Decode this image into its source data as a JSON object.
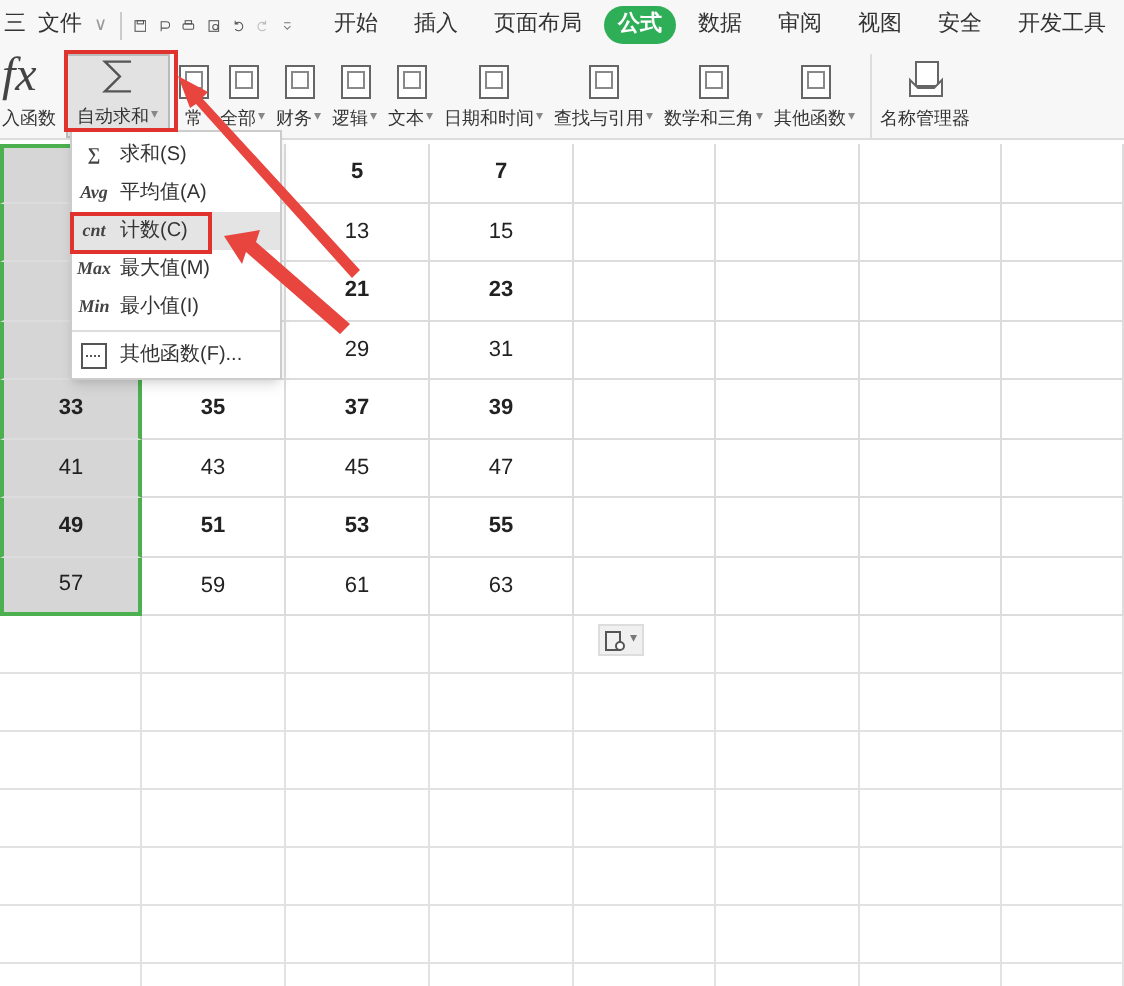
{
  "title_bar": {
    "menu_glyph": "三",
    "file_menu": "文件",
    "file_caret": "∨"
  },
  "menu_tabs": [
    {
      "label": "开始",
      "selected": false
    },
    {
      "label": "插入",
      "selected": false
    },
    {
      "label": "页面布局",
      "selected": false
    },
    {
      "label": "公式",
      "selected": true
    },
    {
      "label": "数据",
      "selected": false
    },
    {
      "label": "审阅",
      "selected": false
    },
    {
      "label": "视图",
      "selected": false
    },
    {
      "label": "安全",
      "selected": false
    },
    {
      "label": "开发工具",
      "selected": false
    }
  ],
  "ribbon": [
    {
      "label": "入函数",
      "kind": "fx",
      "pressed": false
    },
    {
      "label": "自动求和",
      "kind": "sigma",
      "caret": "▾",
      "pressed": true
    },
    {
      "label": "常",
      "kind": "book",
      "pressed": false
    },
    {
      "label": "全部",
      "kind": "book",
      "caret": "▾",
      "pressed": false
    },
    {
      "label": "财务",
      "kind": "book",
      "caret": "▾",
      "pressed": false
    },
    {
      "label": "逻辑",
      "kind": "book",
      "caret": "▾",
      "pressed": false
    },
    {
      "label": "文本",
      "kind": "book",
      "caret": "▾",
      "pressed": false
    },
    {
      "label": "日期和时间",
      "kind": "book",
      "caret": "▾",
      "pressed": false
    },
    {
      "label": "查找与引用",
      "kind": "book",
      "caret": "▾",
      "pressed": false
    },
    {
      "label": "数学和三角",
      "kind": "book",
      "caret": "▾",
      "pressed": false
    },
    {
      "label": "其他函数",
      "kind": "book",
      "caret": "▾",
      "pressed": false
    },
    {
      "label": "名称管理器",
      "kind": "tray",
      "pressed": false
    }
  ],
  "dropdown_menu": [
    {
      "glyph": "∑",
      "label": "求和(S)",
      "highlighted": false
    },
    {
      "glyph": "Avg",
      "label": "平均值(A)",
      "highlighted": false
    },
    {
      "glyph": "cnt",
      "label": "计数(C)",
      "highlighted": true
    },
    {
      "glyph": "Max",
      "label": "最大值(M)",
      "highlighted": false
    },
    {
      "glyph": "Min",
      "label": "最小值(I)",
      "highlighted": false
    },
    {
      "label": "其他函数(F)...",
      "highlighted": false
    }
  ],
  "grid_rows": [
    {
      "bold": true,
      "cells": [
        {
          "selected": true
        },
        {
          "selected": false
        },
        {
          "text": "5",
          "selected": false
        },
        {
          "text": "7",
          "selected": false
        }
      ]
    },
    {
      "bold": false,
      "cells": [
        {
          "selected": true
        },
        {
          "selected": false
        },
        {
          "text": "13",
          "selected": false
        },
        {
          "text": "15",
          "selected": false
        }
      ]
    },
    {
      "bold": true,
      "cells": [
        {
          "selected": true
        },
        {
          "selected": false
        },
        {
          "text": "21",
          "selected": false
        },
        {
          "text": "23",
          "selected": false
        }
      ]
    },
    {
      "bold": false,
      "cells": [
        {
          "selected": true
        },
        {
          "selected": false
        },
        {
          "text": "29",
          "selected": false
        },
        {
          "text": "31",
          "selected": false
        }
      ]
    },
    {
      "bold": true,
      "cells": [
        {
          "text": "33",
          "selected": true
        },
        {
          "text": "35",
          "selected": false
        },
        {
          "text": "37",
          "selected": false
        },
        {
          "text": "39",
          "selected": false
        }
      ]
    },
    {
      "bold": false,
      "cells": [
        {
          "text": "41",
          "selected": true
        },
        {
          "text": "43",
          "selected": false
        },
        {
          "text": "45",
          "selected": false
        },
        {
          "text": "47",
          "selected": false
        }
      ]
    },
    {
      "bold": true,
      "cells": [
        {
          "text": "49",
          "selected": true
        },
        {
          "text": "51",
          "selected": false
        },
        {
          "text": "53",
          "selected": false
        },
        {
          "text": "55",
          "selected": false
        }
      ]
    },
    {
      "bold": false,
      "cells": [
        {
          "text": "57",
          "selected": true
        },
        {
          "text": "59",
          "selected": false
        },
        {
          "text": "61",
          "selected": false
        },
        {
          "text": "63",
          "selected": false
        }
      ]
    }
  ],
  "paste_options": {
    "caret": "▾"
  }
}
